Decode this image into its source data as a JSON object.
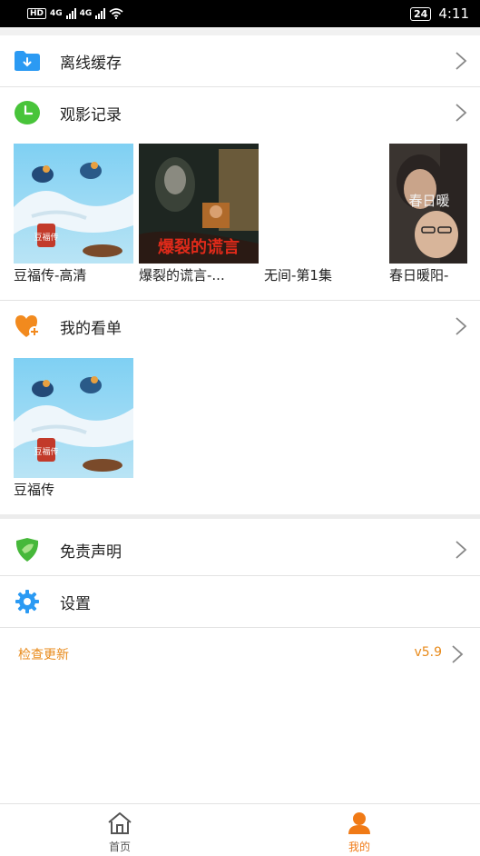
{
  "status_bar": {
    "network": "HD",
    "sim_labels": [
      "4G",
      "4G"
    ],
    "battery": "24",
    "time": "4:11"
  },
  "menu": {
    "offline_cache": "离线缓存",
    "watch_history": "观影记录",
    "my_watchlist": "我的看单",
    "disclaimer": "免责声明",
    "settings": "设置"
  },
  "history": [
    {
      "title": "豆福传-高清"
    },
    {
      "title": "爆裂的谎言-..."
    },
    {
      "title": "无间-第1集"
    },
    {
      "title": "春日暖阳-"
    }
  ],
  "watchlist": [
    {
      "title": "豆福传"
    }
  ],
  "posters": {
    "doufu_text": "豆福传",
    "lie_text": "爆裂的谎言",
    "spring_text": "春日暖"
  },
  "update": {
    "label": "检查更新",
    "version": "v5.9"
  },
  "bottom_nav": {
    "home": "首页",
    "mine": "我的"
  },
  "colors": {
    "accent": "#f07a16",
    "update_text": "#e88a1a",
    "inactive_tab": "#555555"
  }
}
